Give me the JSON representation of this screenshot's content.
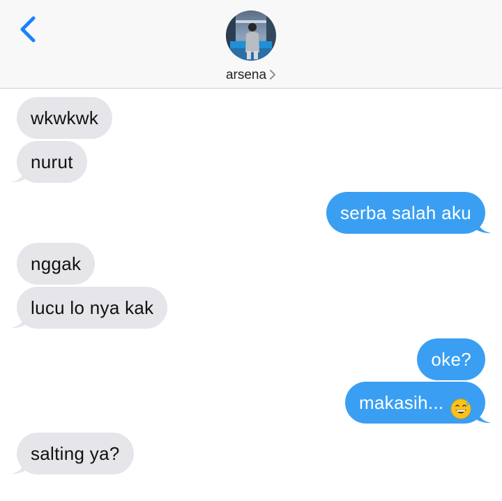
{
  "header": {
    "contact_name": "arsena",
    "back_icon": "chevron-left-icon",
    "accent": "#1a82fb"
  },
  "messages": [
    {
      "side": "received",
      "text": "wkwkwk"
    },
    {
      "side": "received",
      "text": "nurut"
    },
    {
      "side": "sent",
      "text": "serba salah aku"
    },
    {
      "side": "received",
      "text": "nggak"
    },
    {
      "side": "received",
      "text": "lucu lo nya kak"
    },
    {
      "side": "sent",
      "text": "oke?"
    },
    {
      "side": "sent",
      "text": "makasih...",
      "emoji": "grinning-sweat-emoji"
    },
    {
      "side": "received",
      "text": "salting ya?"
    }
  ],
  "colors": {
    "received_bubble": "#e5e5ea",
    "sent_bubble": "#3a9ff2"
  }
}
